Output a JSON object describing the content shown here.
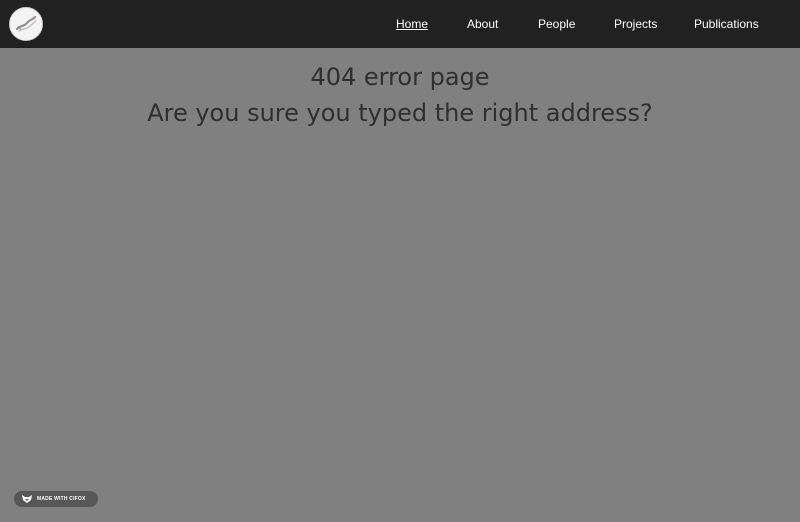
{
  "nav": {
    "logo_icon": "circular-logo-icon",
    "items": [
      {
        "label": "Home",
        "active": true
      },
      {
        "label": "About",
        "active": false
      },
      {
        "label": "People",
        "active": false
      },
      {
        "label": "Projects",
        "active": false
      },
      {
        "label": "Publications",
        "active": false
      }
    ]
  },
  "main": {
    "title": "404 error page",
    "subtitle": "Are you sure you typed the right address?"
  },
  "badge": {
    "icon": "fox-icon",
    "label": "MADE WITH CIFOX"
  },
  "colors": {
    "navbar_background": "#212121",
    "page_background": "#808080",
    "text": "#2f2f2f",
    "nav_text": "#ffffff",
    "badge_background": "#575757"
  }
}
